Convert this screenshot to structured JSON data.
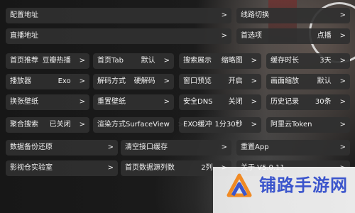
{
  "rows": [
    {
      "id": "config-url",
      "label": "配置地址",
      "value": "",
      "arrow": ">"
    },
    {
      "id": "line-switch",
      "label": "线路切换",
      "value": "",
      "arrow": ">"
    },
    {
      "id": "live-url",
      "label": "直播地址",
      "value": "",
      "arrow": ">"
    },
    {
      "id": "home-source",
      "label": "首选项",
      "value": "点播",
      "arrow": ">"
    },
    {
      "id": "home-recommend",
      "label": "首页推荐",
      "value": "豆瓣热播",
      "arrow": ">"
    },
    {
      "id": "home-tab",
      "label": "首页Tab",
      "value": "默认",
      "arrow": ">"
    },
    {
      "id": "search-display",
      "label": "搜索展示",
      "value": "缩略图",
      "arrow": ">"
    },
    {
      "id": "cache-duration",
      "label": "缓存时长",
      "value": "3天",
      "arrow": ">"
    },
    {
      "id": "player",
      "label": "播放器",
      "value": "Exo",
      "arrow": ">"
    },
    {
      "id": "decode-mode",
      "label": "解码方式",
      "value": "硬解码",
      "arrow": ">"
    },
    {
      "id": "window-preview",
      "label": "窗口预览",
      "value": "开启",
      "arrow": ">"
    },
    {
      "id": "screen-scale",
      "label": "画面缩放",
      "value": "默认",
      "arrow": ">"
    },
    {
      "id": "change-wallpaper",
      "label": "换张壁纸",
      "value": "",
      "arrow": ">"
    },
    {
      "id": "reset-wallpaper",
      "label": "重置壁纸",
      "value": "",
      "arrow": ">"
    },
    {
      "id": "secure-dns",
      "label": "安全DNS",
      "value": "关闭",
      "arrow": ">"
    },
    {
      "id": "history",
      "label": "历史记录",
      "value": "30条",
      "arrow": ">"
    },
    {
      "id": "aggregate-search",
      "label": "聚合搜索",
      "value": "已关闭",
      "arrow": ">"
    },
    {
      "id": "render-mode",
      "label": "渲染方式",
      "value": "SurfaceView",
      "arrow": ">"
    },
    {
      "id": "exo-buffer",
      "label": "EXO缓冲",
      "value": "1分30秒",
      "arrow": ">"
    },
    {
      "id": "aliyun-token",
      "label": "阿里云Token",
      "value": "",
      "arrow": ">"
    },
    {
      "id": "data-backup",
      "label": "数据备份还原",
      "value": "",
      "arrow": ">"
    },
    {
      "id": "clear-cache",
      "label": "清空接口缓存",
      "value": "",
      "arrow": ">"
    },
    {
      "id": "reset-app",
      "label": "重置App",
      "value": "",
      "arrow": ">"
    },
    {
      "id": "video-lab",
      "label": "影视仓实验室",
      "value": "",
      "arrow": ">"
    },
    {
      "id": "home-columns",
      "label": "首页数据源列数",
      "value": "2列",
      "arrow": ">"
    },
    {
      "id": "about",
      "label": "关于 V5.0.11",
      "value": "",
      "arrow": ">"
    }
  ],
  "watermark": {
    "text": "铺路手游网"
  },
  "colors": {
    "card_bg": "#303030",
    "text": "#f1f1f1",
    "watermark_blue": "#3b55cc",
    "watermark_orange": "#f08a24"
  }
}
